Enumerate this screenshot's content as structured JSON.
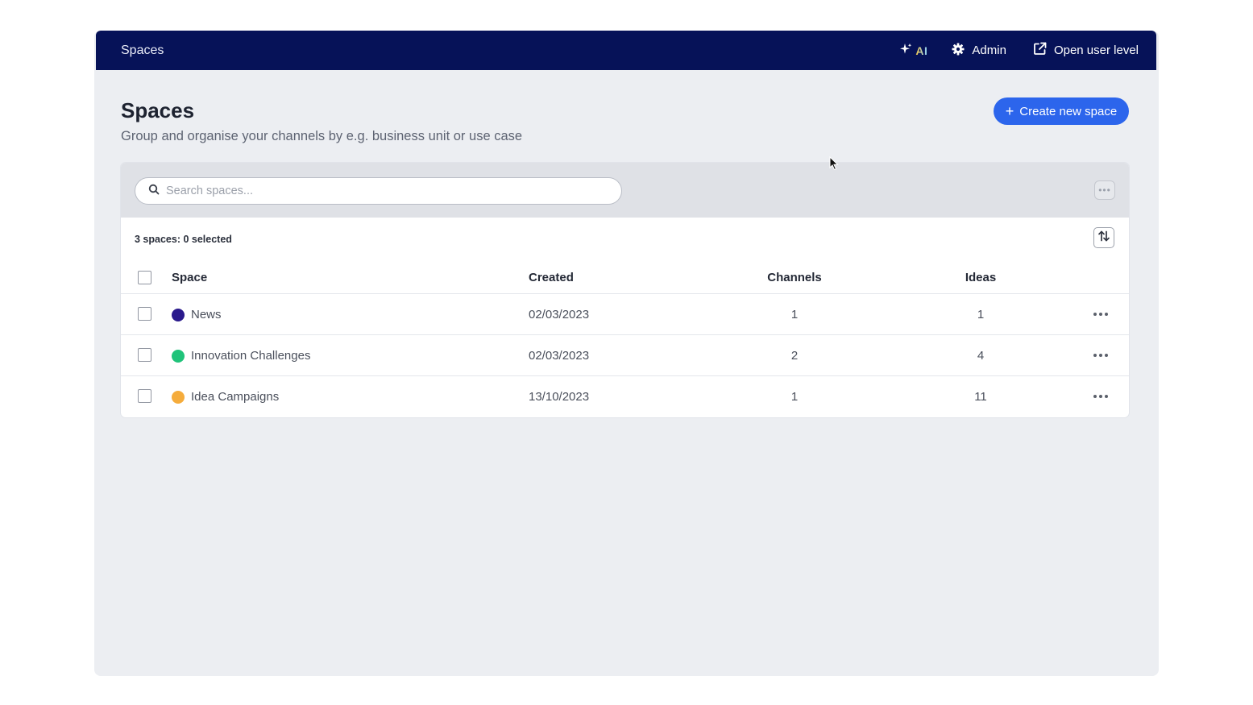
{
  "topbar": {
    "title": "Spaces",
    "ai_label": "AI",
    "admin_label": "Admin",
    "open_user_level_label": "Open user level"
  },
  "page": {
    "title": "Spaces",
    "subtitle": "Group and organise your channels by e.g. business unit or use case",
    "create_button_label": "Create new space"
  },
  "search": {
    "placeholder": "Search spaces...",
    "value": ""
  },
  "summary": {
    "count_label": "3 spaces: 0 selected"
  },
  "table": {
    "headers": {
      "space": "Space",
      "created": "Created",
      "channels": "Channels",
      "ideas": "Ideas"
    },
    "rows": [
      {
        "name": "News",
        "created": "02/03/2023",
        "channels": "1",
        "ideas": "1",
        "color": "#2a1a8c"
      },
      {
        "name": "Innovation Challenges",
        "created": "02/03/2023",
        "channels": "2",
        "ideas": "4",
        "color": "#20c37a"
      },
      {
        "name": "Idea Campaigns",
        "created": "13/10/2023",
        "channels": "1",
        "ideas": "11",
        "color": "#f5ac3c"
      }
    ]
  },
  "colors": {
    "topbar": "#061258",
    "primary": "#2c65ec",
    "background": "#eceef2"
  }
}
